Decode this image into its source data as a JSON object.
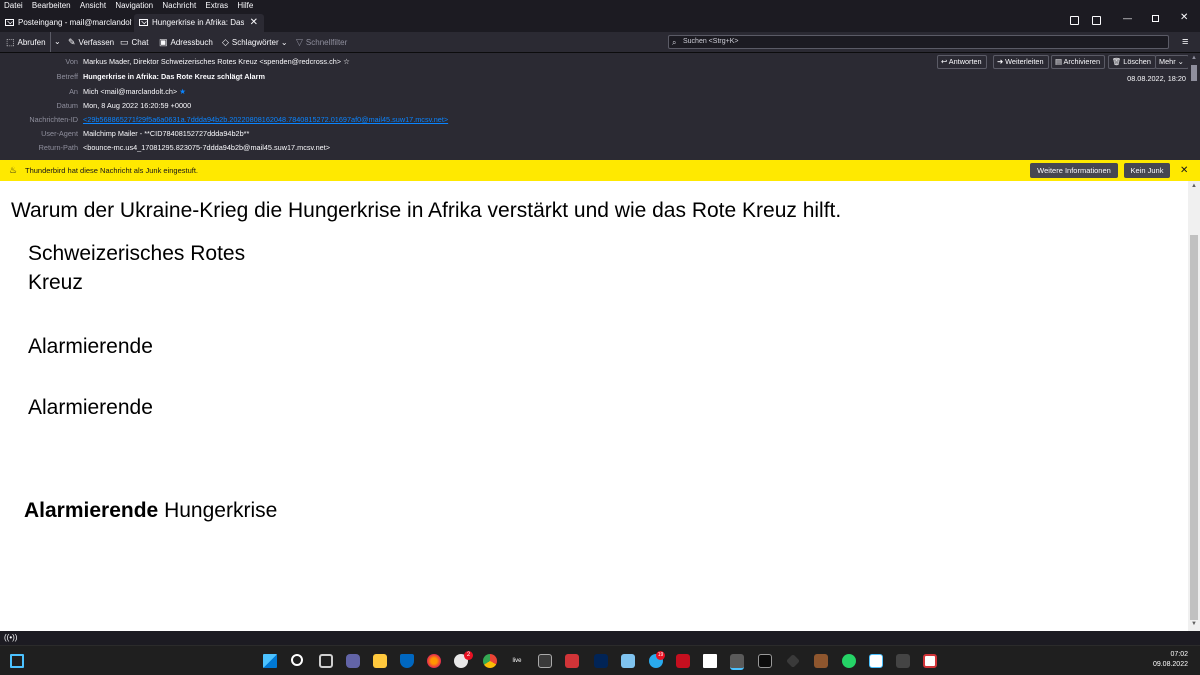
{
  "menubar": {
    "items": [
      "Datei",
      "Bearbeiten",
      "Ansicht",
      "Navigation",
      "Nachricht",
      "Extras",
      "Hilfe"
    ]
  },
  "tabs": [
    {
      "label": "Posteingang - mail@marclandolt.ch"
    },
    {
      "label": "Hungerkrise in Afrika: Das Rote Kreuz schlägt Alarm"
    }
  ],
  "toolbar": {
    "fetch": "Abrufen",
    "compose": "Verfassen",
    "chat": "Chat",
    "addressbook": "Adressbuch",
    "tags": "Schlagwörter",
    "quickfilter": "Schnellfilter",
    "search_placeholder": "Suchen <Strg+K>"
  },
  "header": {
    "from_label": "Von",
    "from_value": "Markus Mader, Direktor Schweizerisches Rotes Kreuz <spenden@redcross.ch> ☆",
    "subject_label": "Betreff",
    "subject_value": "Hungerkrise in Afrika: Das Rote Kreuz schlägt Alarm",
    "to_label": "An",
    "to_value": "Mich <mail@marclandolt.ch>",
    "date_label": "Datum",
    "date_value": "Mon, 8 Aug 2022 16:20:59 +0000",
    "msgid_label": "Nachrichten-ID",
    "msgid_value": "<29b568865271f29f5a6a0631a.7ddda94b2b.20220808162048.7840815272.01697af0@mail45.suw17.mcsv.net>",
    "useragent_label": "User-Agent",
    "useragent_value": "Mailchimp Mailer - **CID78408152727ddda94b2b**",
    "returnpath_label": "Return-Path",
    "returnpath_value": "<bounce-mc.us4_17081295.823075-7ddda94b2b@mail45.suw17.mcsv.net>",
    "date_short": "08.08.2022, 18:20",
    "buttons": {
      "reply": "Antworten",
      "forward": "Weiterleiten",
      "archive": "Archivieren",
      "delete": "Löschen",
      "more": "Mehr"
    }
  },
  "junkbar": {
    "message": "Thunderbird hat diese Nachricht als Junk eingestuft.",
    "info_button": "Weitere Informationen",
    "notjunk_button": "Kein Junk"
  },
  "body": {
    "headline": "Warum der Ukraine-Krieg die Hungerkrise in Afrika verstärkt und wie das Rote Kreuz hilft.",
    "logo_line1": "Schweizerisches Rotes",
    "logo_line2": "Kreuz",
    "alt1": "Alarmierende",
    "alt2": "Alarmierende",
    "title_bold": "Alarmierende",
    "title_rest": " Hungerkrise"
  },
  "taskbar": {
    "time": "07:02",
    "date": "09.08.2022",
    "badge_mail": "2",
    "badge_telegram": "19"
  },
  "colors": {
    "accent": "#0a84ff",
    "junk_bar": "#ffe900",
    "dark_bg": "#1c1b22",
    "panel_bg": "#2b2a33"
  }
}
